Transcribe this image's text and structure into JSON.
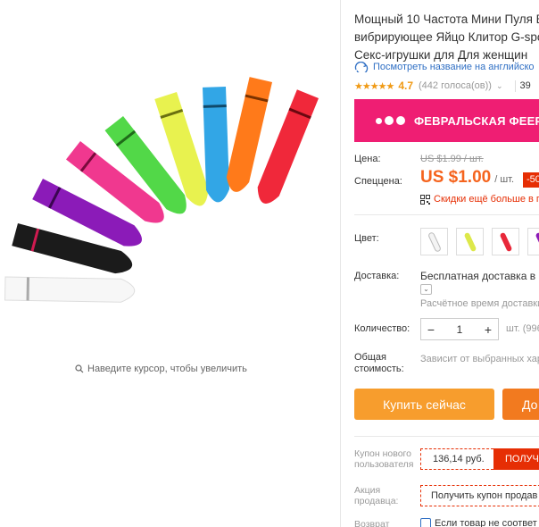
{
  "gallery": {
    "zoom_hint": "Наведите курсор, чтобы увеличить"
  },
  "product": {
    "title_lines": [
      "Мощный 10 Частота Мини Пуля В",
      "вибрирующее Яйцо Клитор G-spo",
      "Секс-игрушки для Для женщин"
    ],
    "translate_link": "Посмотреть название на английско",
    "rating": {
      "stars": "★★★★★",
      "value": "4.7",
      "votes": "(442 голоса(ов))",
      "orders": "39"
    }
  },
  "promo": {
    "text": "ФЕВРАЛЬСКАЯ ФЕЕР",
    "color": "#ef1e73"
  },
  "price": {
    "label_price": "Цена:",
    "old": "US $1.99 / шт.",
    "label_special": "Спеццена:",
    "new": "US $1.00",
    "unit": "/ шт.",
    "discount": "-50",
    "qr_text": "Скидки ещё больше в п",
    "accent": "#f5641e"
  },
  "options": {
    "color_label": "Цвет:",
    "swatches": [
      "white",
      "yellow",
      "red",
      "purple"
    ],
    "shipping_label": "Доставка:",
    "shipping_value": "Бесплатная доставка в R",
    "shipping_time": "Расчётное время доставки",
    "quantity_label": "Количество:",
    "quantity_minus": "−",
    "quantity_value": "1",
    "quantity_plus": "+",
    "quantity_unit": "шт. (996",
    "total_label_1": "Общая",
    "total_label_2": "стоимость:",
    "total_value": "Зависит от выбранных хар"
  },
  "actions": {
    "buy_now": "Купить сейчас",
    "add_to_cart": "До"
  },
  "coupons": {
    "new_user_label_1": "Купон нового",
    "new_user_label_2": "пользователя",
    "new_user_value": "136,14 руб.",
    "new_user_get": "ПОЛУЧИ",
    "seller_label_1": "Акция",
    "seller_label_2": "продавца:",
    "seller_value": "Получить купон продав",
    "return_label": "Возврат",
    "return_text": "Если товар не соответ"
  }
}
